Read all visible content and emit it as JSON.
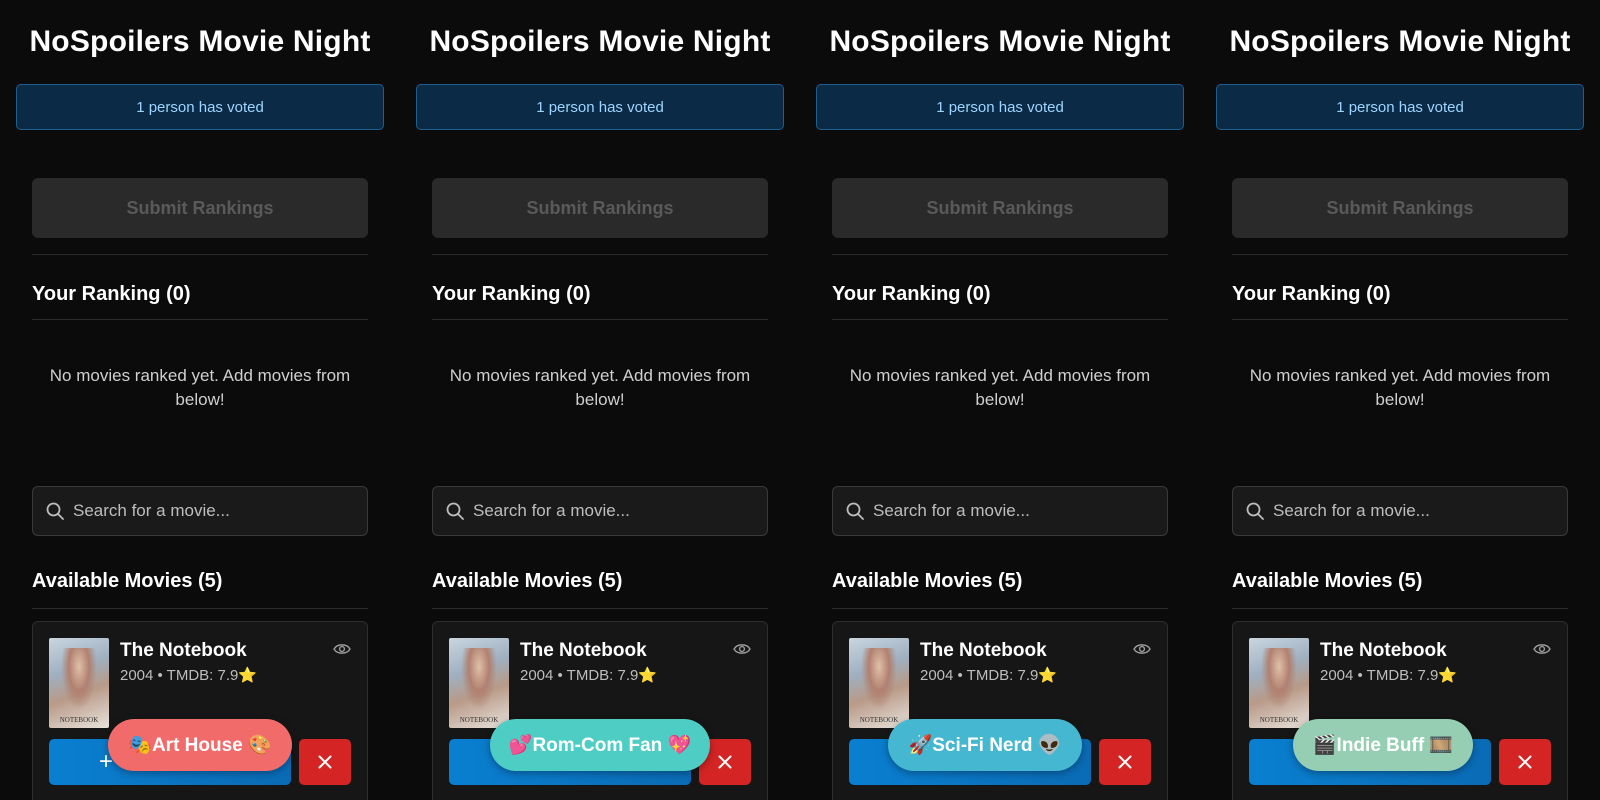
{
  "app_title": "NoSpoilers Movie Night",
  "vote_status": "1 person has voted",
  "submit_label": "Submit Rankings",
  "ranking_title": "Your Ranking (0)",
  "empty_message": "No movies ranked yet. Add movies from below!",
  "search_placeholder": "Search for a movie...",
  "available_title": "Available Movies (5)",
  "movie": {
    "title": "The Notebook",
    "meta": "2004 • TMDB: 7.9⭐",
    "poster_caption": "NOTEBOOK"
  },
  "add_label": "+",
  "colors": {
    "accent_blue": "#0a7fd0",
    "danger_red": "#d42424",
    "banner_bg": "#0a2a46"
  },
  "panels": [
    {
      "persona": "🎭Art House 🎨",
      "persona_color": "#f26b6b"
    },
    {
      "persona": "💕Rom-Com Fan 💖",
      "persona_color": "#4ecdc4"
    },
    {
      "persona": "🚀Sci-Fi Nerd 👽",
      "persona_color": "#45b7d1"
    },
    {
      "persona": "🎬Indie Buff 🎞️",
      "persona_color": "#96ceb4"
    }
  ]
}
